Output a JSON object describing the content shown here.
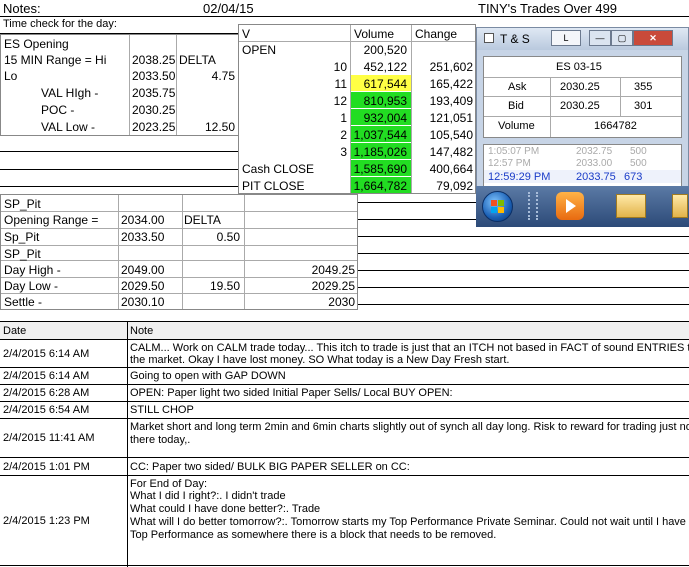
{
  "header": {
    "notes_label": "Notes:",
    "date": "02/04/15",
    "title": "TINY's Trades Over 499",
    "time_check": "Time check for the day:"
  },
  "es_block": {
    "title": "ES Opening",
    "rows": [
      {
        "label": "15 MIN Range = Hi",
        "value": "2038.25",
        "extra": "DELTA"
      },
      {
        "label": "Lo",
        "value": "2033.50",
        "extra": "4.75"
      },
      {
        "label": "VAL HIgh   -",
        "value": "2035.75",
        "extra": ""
      },
      {
        "label": "POC  -",
        "value": "2030.25",
        "extra": ""
      },
      {
        "label": "VAL Low   -",
        "value": "2023.25",
        "extra": "12.50"
      }
    ]
  },
  "volume_table": {
    "headers": {
      "v": "V",
      "volume": "Volume",
      "change": "Change"
    },
    "open_label": "OPEN",
    "open_volume": "200,520",
    "rows": [
      {
        "v": "10",
        "volume": "452,122",
        "change": "251,602",
        "color": "none"
      },
      {
        "v": "11",
        "volume": "617,544",
        "change": "165,422",
        "color": "yellow"
      },
      {
        "v": "12",
        "volume": "810,953",
        "change": "193,409",
        "color": "green"
      },
      {
        "v": "1",
        "volume": "932,004",
        "change": "121,051",
        "color": "green"
      },
      {
        "v": "2",
        "volume": "1,037,544",
        "change": "105,540",
        "color": "green"
      },
      {
        "v": "3",
        "volume": "1,185,026",
        "change": "147,482",
        "color": "green"
      }
    ],
    "cash_close_label": "Cash CLOSE",
    "cash_close_volume": "1,585,690",
    "cash_close_change": "400,664",
    "pit_close_label": "PIT CLOSE",
    "pit_close_volume": "1,664,782",
    "pit_close_change": "79,092"
  },
  "ts_window": {
    "title": "T & S",
    "l_button": "L",
    "symbol": "ES 03-15",
    "ask_label": "Ask",
    "ask_price": "2030.25",
    "ask_size": "355",
    "bid_label": "Bid",
    "bid_price": "2030.25",
    "bid_size": "301",
    "volume_label": "Volume",
    "volume_value": "1664782",
    "trades": [
      {
        "time": "1:05:07 PM",
        "price": "2032.75",
        "size": "500",
        "style": "faded"
      },
      {
        "time": "12:57 PM",
        "price": "2033.00",
        "size": "500",
        "style": "faded"
      },
      {
        "time": "12:59:29 PM",
        "price": "2033.75",
        "size": "673",
        "style": "blue"
      }
    ]
  },
  "sp_block": {
    "title": "SP_Pit",
    "rows": [
      {
        "label": "Opening Range =",
        "value": "2034.00",
        "extra": "DELTA",
        "far": ""
      },
      {
        "label": "Sp_Pit",
        "value": "2033.50",
        "extra": "0.50",
        "far": ""
      },
      {
        "label": "SP_Pit",
        "value": "",
        "extra": "",
        "far": ""
      },
      {
        "label": "Day High -",
        "value": "2049.00",
        "extra": "",
        "far": "2049.25"
      },
      {
        "label": "Day Low -",
        "value": "2029.50",
        "extra": "19.50",
        "far": "2029.25"
      },
      {
        "label": "Settle -",
        "value": "2030.10",
        "extra": "",
        "far": "2030"
      }
    ]
  },
  "log": {
    "date_header": "Date",
    "note_header": "Note",
    "entries": [
      {
        "date": "2/4/2015 6:14 AM",
        "note_lines": [
          "CALM... Work on CALM trade today... This itch to trade is just that an ITCH not based in FACT of sound ENTRIES to",
          "the market.  Okay I have lost money.  SO  What today is a New Day Fresh start."
        ]
      },
      {
        "date": "2/4/2015 6:14 AM",
        "note_lines": [
          "Going to open with GAP DOWN"
        ]
      },
      {
        "date": "2/4/2015 6:28 AM",
        "note_lines": [
          "OPEN: Paper light two sided Initial Paper Sells/ Local BUY OPEN:"
        ]
      },
      {
        "date": "2/4/2015 6:54 AM",
        "note_lines": [
          "STILL CHOP"
        ]
      },
      {
        "date": "2/4/2015 11:41 AM",
        "note_lines": [
          "Market short and long term 2min and 6min charts slightly out of synch all day long.  Risk to reward for trading just noe",
          "there today,."
        ]
      },
      {
        "date": "2/4/2015 1:01 PM",
        "note_lines": [
          "CC: Paper two sided/ BULK BIG PAPER SELLER on CC:"
        ]
      },
      {
        "date": "2/4/2015 1:23 PM",
        "note_lines": [
          "For End of Day:",
          "What I did I right?:.  I didn't trade",
          "What could I have done better?:.  Trade",
          "What will I do better tomorrow?:.  Tomorrow starts my Top Performance Private Seminar.  Could not wait until I have",
          "Top Performance as somewhere there is a block that needs to be removed."
        ]
      }
    ]
  },
  "colors": {
    "green": "#22dd22",
    "yellow": "#ffff44",
    "blue_text": "#1a3cc8"
  }
}
